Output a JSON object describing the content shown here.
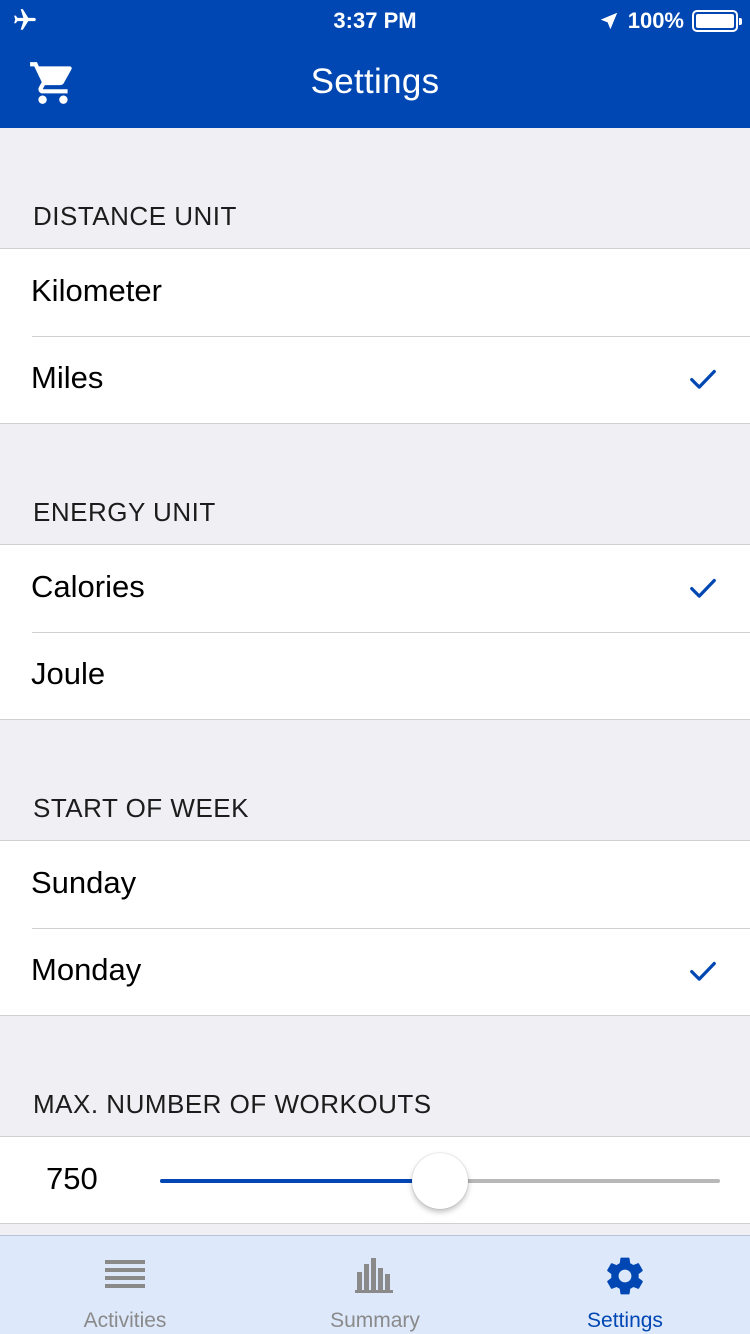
{
  "status_bar": {
    "time": "3:37 PM",
    "battery": "100%"
  },
  "nav": {
    "title": "Settings",
    "cart_icon": "cart-icon"
  },
  "colors": {
    "accent": "#0047b3",
    "background": "#efeff4",
    "tabbar": "#dde8fa"
  },
  "sections": {
    "distance": {
      "header": "DISTANCE UNIT",
      "items": [
        {
          "label": "Kilometer",
          "selected": false
        },
        {
          "label": "Miles",
          "selected": true
        }
      ]
    },
    "energy": {
      "header": "ENERGY UNIT",
      "items": [
        {
          "label": "Calories",
          "selected": true
        },
        {
          "label": "Joule",
          "selected": false
        }
      ]
    },
    "week": {
      "header": "START OF WEEK",
      "items": [
        {
          "label": "Sunday",
          "selected": false
        },
        {
          "label": "Monday",
          "selected": true
        }
      ]
    },
    "workouts": {
      "header": "MAX. NUMBER OF WORKOUTS",
      "value": "750",
      "slider_fraction": 0.5
    }
  },
  "tabs": [
    {
      "label": "Activities",
      "icon": "list-icon",
      "active": false
    },
    {
      "label": "Summary",
      "icon": "bar-chart-icon",
      "active": false
    },
    {
      "label": "Settings",
      "icon": "gear-icon",
      "active": true
    }
  ]
}
